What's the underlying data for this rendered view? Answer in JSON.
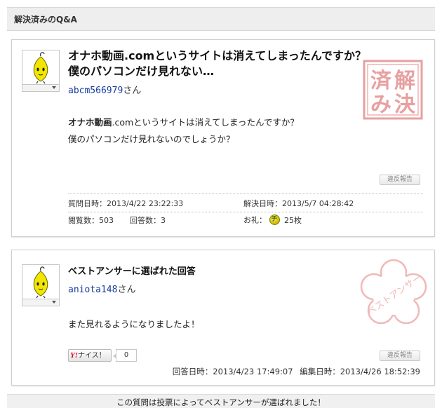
{
  "section_header": "解決済みのQ&A",
  "question": {
    "title": "オナホ動画.comというサイトは消えてしまったんですか？ 僕のパソコンだけ見れない…",
    "user": {
      "name": "abcm566979",
      "suffix": "さん"
    },
    "body_line1_bold": "オナホ動画",
    "body_line1_rest": ".comというサイトは消えてしまったんですか？",
    "body_line2": "僕のパソコンだけ見れないのでしょうか？",
    "report_label": "違反報告",
    "posted_label": "質問日時：",
    "posted_value": "2013/4/22 23:22:33",
    "resolved_label": "解決日時：",
    "resolved_value": "2013/5/7 04:28:42",
    "views_label": "閲覧数：",
    "views_value": "503",
    "answers_label": "回答数：",
    "answers_value": "3",
    "reward_label": "お礼：",
    "reward_value": "25枚",
    "coin_glyph": "チ",
    "stamp_chars": [
      "解",
      "済",
      "決",
      "み"
    ],
    "stamp_color": "#e8a0a0"
  },
  "best_answer": {
    "heading": "ベストアンサーに選ばれた回答",
    "user": {
      "name": "aniota148",
      "suffix": "さん"
    },
    "body": "また見れるようになりましたよ！",
    "report_label": "違反報告",
    "nice_logo": "Y!",
    "nice_label": "ナイス！",
    "nice_count": "0",
    "answered_label": "回答日時：",
    "answered_value": "2013/4/23 17:49:07",
    "edited_label": "編集日時：",
    "edited_value": "2013/4/26 18:52:39",
    "stamp_text": "ベストアンサー",
    "stamp_color": "#f0b8b8"
  },
  "footer_notice": "この質問は投票によってベストアンサーが選ばれました！"
}
